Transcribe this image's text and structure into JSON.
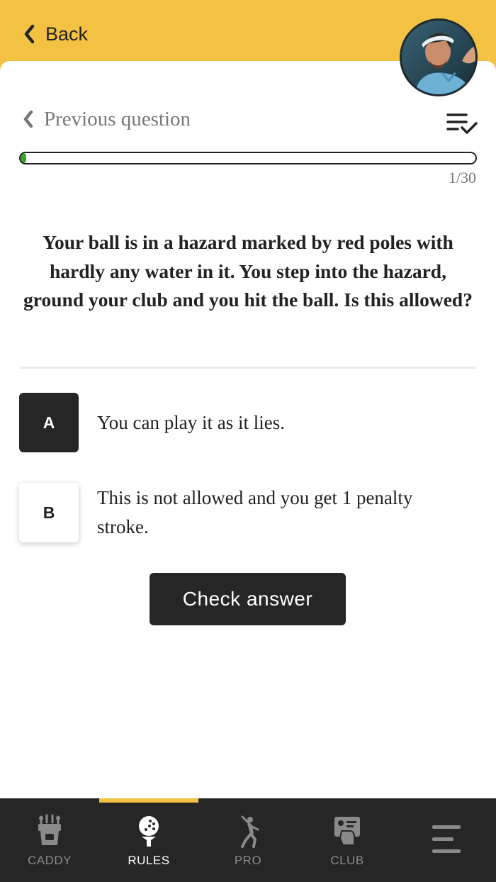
{
  "header": {
    "back_label": "Back"
  },
  "quiz": {
    "previous_label": "Previous question",
    "progress_current": 1,
    "progress_total": 30,
    "progress_text": "1/30",
    "question": "Your ball is in a hazard marked by red poles with hardly any water in it. You step into the hazard, ground your club and you hit the ball. Is this allowed?",
    "options": [
      {
        "key": "A",
        "text": "You can play it as it lies.",
        "selected": true
      },
      {
        "key": "B",
        "text": "This is not allowed and you get 1 penalty stroke.",
        "selected": false
      }
    ],
    "check_label": "Check answer"
  },
  "nav": {
    "items": [
      {
        "label": "CADDY",
        "icon": "golf-bag-icon",
        "active": false
      },
      {
        "label": "RULES",
        "icon": "golf-ball-tee-icon",
        "active": true
      },
      {
        "label": "PRO",
        "icon": "golfer-swing-icon",
        "active": false
      },
      {
        "label": "CLUB",
        "icon": "club-card-icon",
        "active": false
      },
      {
        "label": "",
        "icon": "hamburger-menu-icon",
        "active": false
      }
    ]
  },
  "colors": {
    "accent": "#f3c242",
    "dark": "#262626",
    "progress": "#3aa52a"
  }
}
